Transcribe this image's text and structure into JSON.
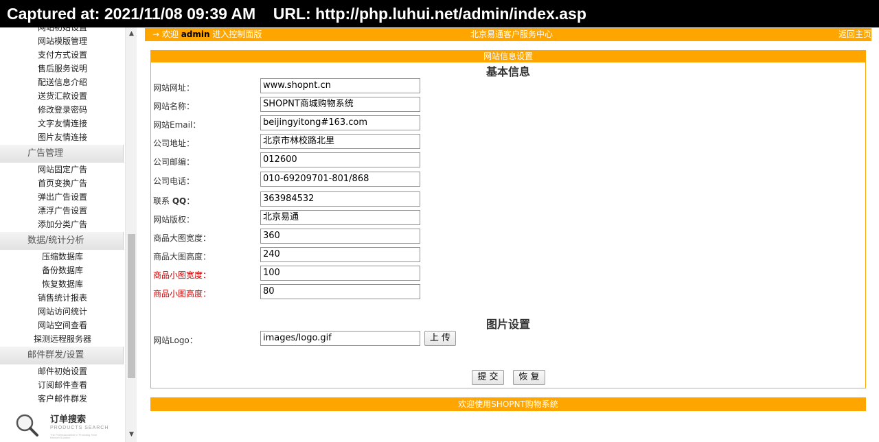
{
  "capture": {
    "text": "Captured at: 2021/11/08 09:39 AM    URL: http://php.luhui.net/admin/index.asp"
  },
  "sidebar": {
    "group1": [
      "网站初始设置",
      "网站模版管理",
      "支付方式设置",
      "售后服务说明",
      "配送信息介绍",
      "送货汇款设置",
      "修改登录密码",
      "文字友情连接",
      "图片友情连接"
    ],
    "ads_head": "广告管理",
    "ads": [
      "网站固定广告",
      "首页变换广告",
      "弹出广告设置",
      "漂浮广告设置",
      "添加分类广告"
    ],
    "stats_head": "数据/统计分析",
    "stats": [
      "压缩数据库",
      "备份数据库",
      "恢复数据库",
      "销售统计报表",
      "网站访问统计",
      "网站空间查看",
      "探测远程服务器"
    ],
    "mail_head": "邮件群发/设置",
    "mail": [
      "邮件初始设置",
      "订阅邮件查看",
      "客户邮件群发"
    ],
    "search_title": "订单搜索",
    "search_sub": "PRODUCTS SEARCH",
    "search_tiny": "The Professionalism in Providing Total Internet Solution"
  },
  "topbar": {
    "welcome_prefix": "→ 欢迎",
    "user": "admin",
    "welcome_suffix": "进入控制面版",
    "center": "北京易通客户服务中心",
    "right": "返回主页"
  },
  "panel": {
    "header": "网站信息设置",
    "basic_title": "基本信息",
    "fields": [
      {
        "label": "网站网址：",
        "value": "www.shopnt.cn"
      },
      {
        "label": "网站名称：",
        "value": "SHOPNT商城购物系统"
      },
      {
        "label": "网站Email：",
        "value": "beijingyitong#163.com"
      },
      {
        "label": "公司地址：",
        "value": "北京市林校路北里"
      },
      {
        "label": "公司邮编：",
        "value": "012600"
      },
      {
        "label": "公司电话：",
        "value": "010-69209701-801/868"
      },
      {
        "label_prefix": "联系",
        "label_bold": "QQ",
        "label_suffix": "：",
        "value": "363984532"
      },
      {
        "label": "网站版权：",
        "value": "北京易通"
      },
      {
        "label": "商品大图宽度：",
        "value": "360"
      },
      {
        "label": "商品大图高度：",
        "value": "240"
      },
      {
        "label": "商品小图宽度：",
        "value": "100"
      },
      {
        "label": "商品小图高度：",
        "value": "80"
      }
    ],
    "image_title": "图片设置",
    "logo_label": "网站Logo：",
    "logo_value": "images/logo.gif",
    "upload_label": "上 传",
    "submit_label": "提 交",
    "reset_label": "恢 复"
  },
  "footer": {
    "text": "欢迎使用SHOPNT购物系统"
  },
  "colors": {
    "accent": "#ffa500",
    "warning_label": "#cc0000"
  }
}
